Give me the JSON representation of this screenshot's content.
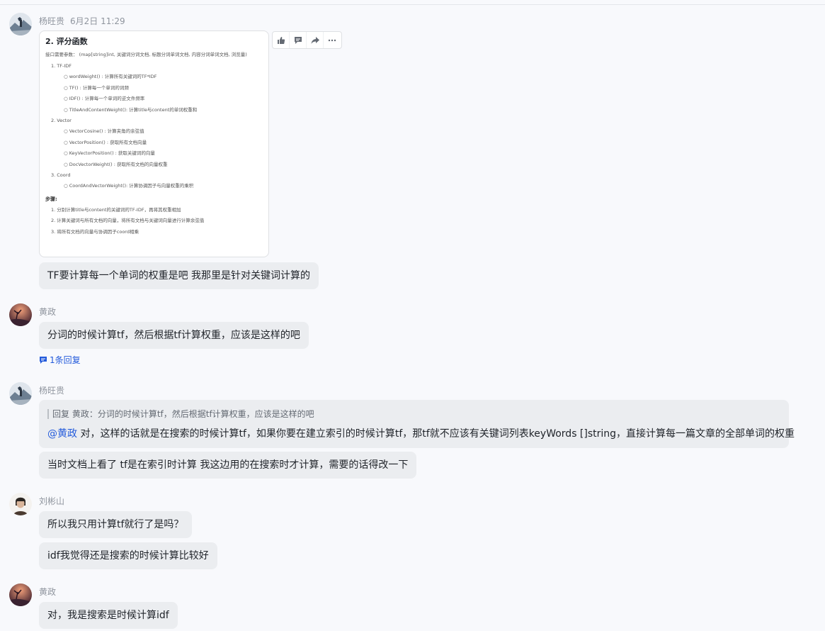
{
  "messages": [
    {
      "sender": "杨旺贵",
      "time": "6月2日 11:29",
      "image": {
        "heading": "2. 评分函数",
        "intro": "接口需要参数： (map[string]int, 关键词分词文档, 标题分词单词文档, 内容分词单词文档, 浏览量)",
        "items": [
          {
            "level": 1,
            "text": "1. TF-IDF"
          },
          {
            "level": 2,
            "text": "○  wordWeight() : 计算所有关键词的TF*IDF"
          },
          {
            "level": 2,
            "text": "○  TF() : 计算每一个单词的词频"
          },
          {
            "level": 2,
            "text": "○  IDF() : 计算每一个单词的逆文件频率"
          },
          {
            "level": 2,
            "text": "○  TitleAndContentWeight(): 计算title与content的单词权重和"
          },
          {
            "level": 1,
            "text": "2. Vector"
          },
          {
            "level": 2,
            "text": "○  VectorCosine() : 计算夹角的余弦值"
          },
          {
            "level": 2,
            "text": "○  VectorPosition() : 获取所有文档向量"
          },
          {
            "level": 2,
            "text": "○  KeyVectorPosition() : 获取关键词的向量"
          },
          {
            "level": 2,
            "text": "○  DocVectorWeight() : 获取所有文档的向量权重"
          },
          {
            "level": 1,
            "text": "3. Coord"
          },
          {
            "level": 2,
            "text": "○  CoordAndVectorWeight(): 计算协调因子与向量权重的乘积"
          }
        ],
        "steps_title": "步骤:",
        "steps": [
          "1. 分别计算title与content的关键词的TF-IDF，再将其权重相加",
          "2. 计算关键词与所有文档的向量，将所有文档与关键词向量进行计算余弦值",
          "3. 将所有文档的向量与协调因子coord相乘"
        ]
      },
      "text": "TF要计算每一个单词的权重是吧    我那里是针对关键词计算的"
    },
    {
      "sender": "黄政",
      "text": "分词的时候计算tf，然后根据tf计算权重，应该是这样的吧",
      "reply_count": "1条回复"
    },
    {
      "sender": "杨旺贵",
      "quote": "回复 黄政：分词的时候计算tf，然后根据tf计算权重，应该是这样的吧",
      "mention": "@黄政",
      "text": " 对，这样的话就是在搜索的时候计算tf，如果你要在建立索引的时候计算tf，那tf就不应该有关键词列表keyWords []string，直接计算每一篇文章的全部单词的权重",
      "text2": "当时文档上看了  tf是在索引时计算  我这边用的在搜索时才计算，需要的话得改一下"
    },
    {
      "sender": "刘彬山",
      "text": "所以我只用计算tf就行了是吗？",
      "text2": "idf我觉得还是搜索的时候计算比较好"
    },
    {
      "sender": "黄政",
      "text": "对，我是搜索是时候计算idf"
    }
  ],
  "toolbar_icons": [
    "thumbs-up-icon",
    "comment-icon",
    "forward-icon",
    "more-icon"
  ],
  "colors": {
    "accent": "#245bdb",
    "bubble": "#ebedf0",
    "background": "#f8f9fc"
  }
}
